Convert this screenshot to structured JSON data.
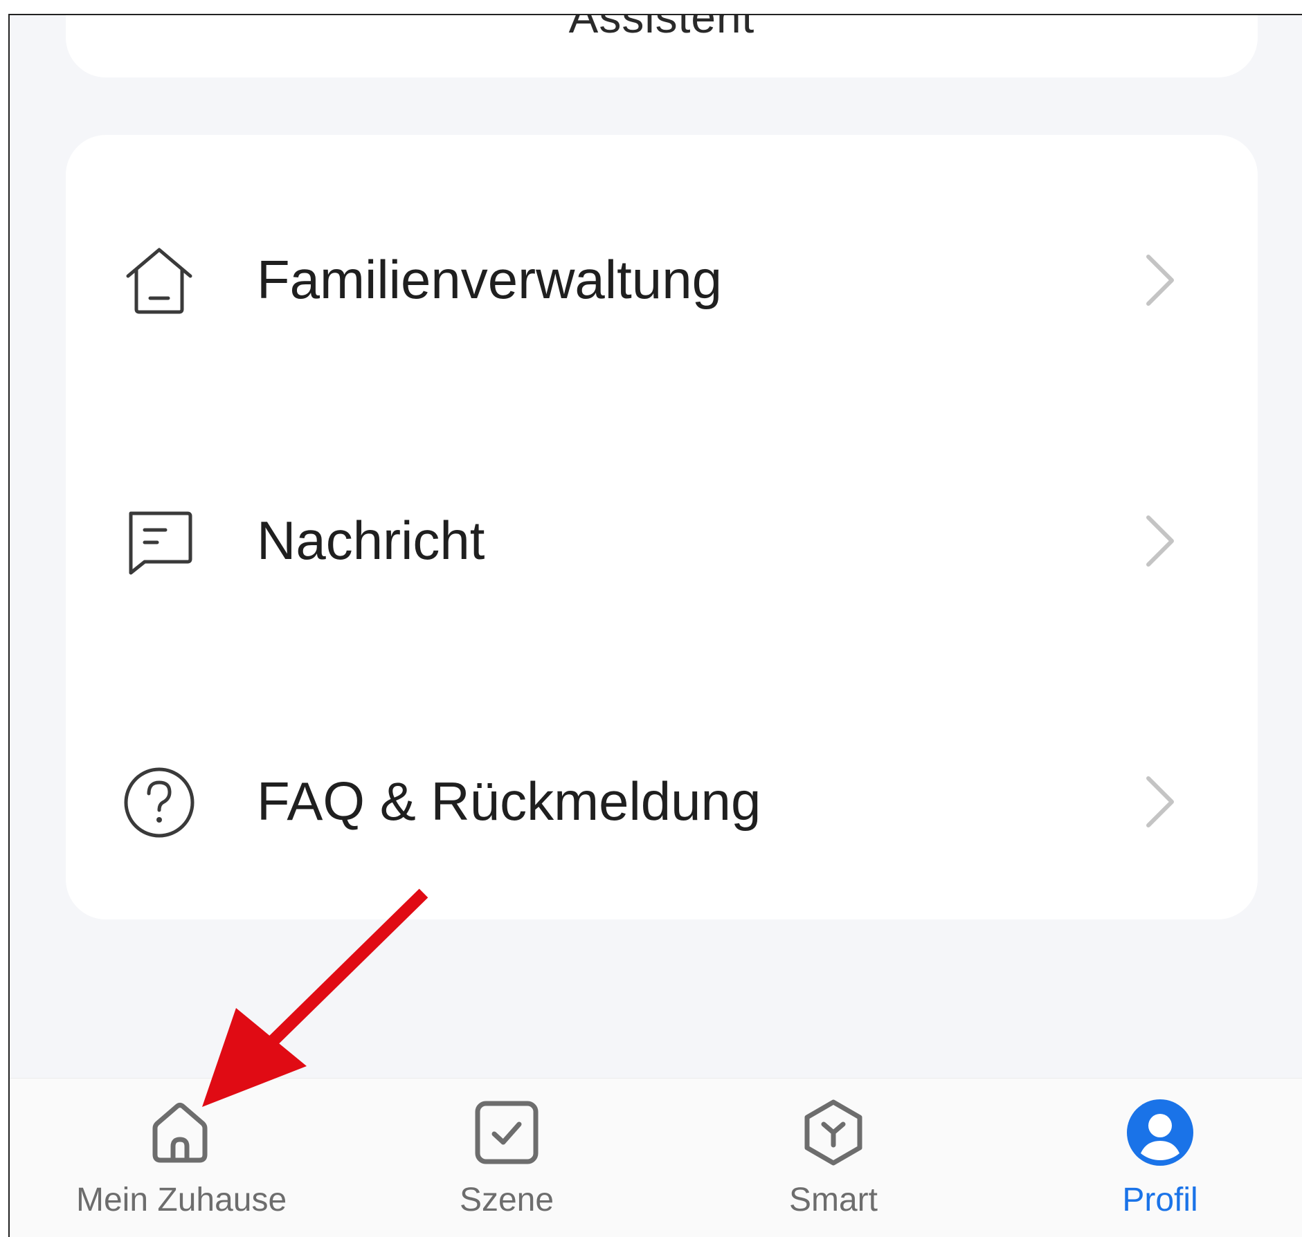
{
  "top_card": {
    "label": "Assistent"
  },
  "menu": {
    "items": [
      {
        "label": "Familienverwaltung",
        "icon": "house-outline-icon"
      },
      {
        "label": "Nachricht",
        "icon": "message-icon"
      },
      {
        "label": "FAQ & Rückmeldung",
        "icon": "question-circle-icon"
      }
    ]
  },
  "tabbar": {
    "items": [
      {
        "label": "Mein Zuhause",
        "icon": "home-icon",
        "active": false
      },
      {
        "label": "Szene",
        "icon": "checkbox-icon",
        "active": false
      },
      {
        "label": "Smart",
        "icon": "smart-cube-icon",
        "active": false
      },
      {
        "label": "Profil",
        "icon": "profile-icon",
        "active": true
      }
    ]
  },
  "colors": {
    "background": "#f5f6f9",
    "card": "#ffffff",
    "text": "#1f1f1f",
    "tab_inactive": "#6d6d6d",
    "tab_active": "#1a73e8",
    "annotation": "#e00b14"
  }
}
